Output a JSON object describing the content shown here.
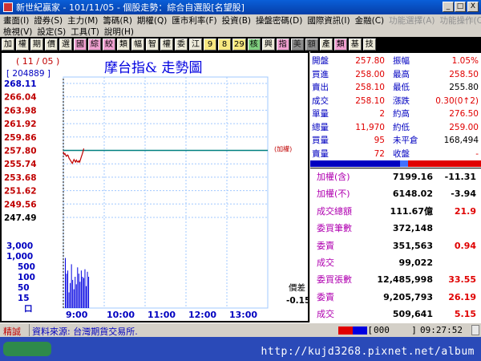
{
  "window": {
    "title": "新世紀贏家 - 101/11/05 - 個股走勢：綜合自選股[名望股]",
    "buttons": [
      "_",
      "□",
      "X"
    ]
  },
  "menu": {
    "row1": [
      "畫面(I)",
      "證券(S)",
      "主力(M)",
      "籌碼(R)",
      "期權(Q)",
      "匯市利率(F)",
      "投資(B)",
      "操盤密碼(D)",
      "國際資訊(I)",
      "金融(C)",
      "功能選擇(A)",
      "功能操作(C)"
    ],
    "row2": [
      "檢視(V)",
      "設定(S)",
      "工具(T)",
      "說明(H)"
    ]
  },
  "toolbar": [
    "加",
    "權",
    "期",
    "價",
    "選",
    "國",
    "綜",
    "絞",
    "類",
    "幅",
    "智",
    "權",
    "委",
    "江",
    "9",
    "8",
    "29",
    "核",
    "興",
    "指",
    "美",
    "額",
    "產",
    "類",
    "基",
    "技"
  ],
  "chart": {
    "date": "( 11 / 05 )",
    "volume_code": "[ 204889 ]",
    "title": "摩台指&  走勢圖",
    "price_ticks": [
      "268.11",
      "266.04",
      "263.98",
      "261.92",
      "259.86",
      "257.80",
      "255.74",
      "253.68",
      "251.62",
      "249.56",
      "247.49"
    ],
    "volume_ticks": [
      "3,000",
      "1,000",
      "500",
      "100",
      "50",
      "15",
      "口"
    ],
    "time_ticks": [
      "9:00",
      "10:00",
      "11:00",
      "12:00",
      "13:00"
    ],
    "ref_label": "(加權)",
    "diff_label": "價差",
    "diff_value": "-0.15",
    "reference_price": 257.8,
    "price_series": [
      257.6,
      257.2,
      257.3,
      257.0,
      256.9,
      257.1,
      257.0,
      256.6,
      256.4,
      256.2,
      256.0,
      255.8,
      256.1,
      256.4,
      256.2,
      256.0,
      256.3,
      256.1,
      256.0,
      256.2,
      256.0,
      256.4,
      256.8,
      257.2,
      257.6,
      258.1
    ],
    "volume_series": [
      0.8,
      0.55,
      0.6,
      0.25,
      0.4,
      0.7,
      0.45,
      0.3,
      0.5,
      0.38,
      0.65,
      0.55,
      0.42,
      0.6,
      0.5,
      0.48,
      0.62,
      0.35,
      0.58,
      0.5
    ]
  },
  "quote": {
    "rows": [
      {
        "l1": "開盤",
        "v1": "257.80",
        "l2": "振幅",
        "v2": "1.05%",
        "c1": "red",
        "c2": "red"
      },
      {
        "l1": "買進",
        "v1": "258.00",
        "l2": "最高",
        "v2": "258.50",
        "c1": "red",
        "c2": "red"
      },
      {
        "l1": "賣出",
        "v1": "258.10",
        "l2": "最低",
        "v2": "255.80",
        "c1": "red",
        "c2": "blk"
      },
      {
        "l1": "成交",
        "v1": "258.10",
        "l2": "漲跌",
        "v2": "0.30(0↑2)",
        "c1": "red",
        "c2": "red"
      },
      {
        "l1": "單量",
        "v1": "2",
        "l2": "約高",
        "v2": "276.50",
        "c1": "red",
        "c2": "red"
      },
      {
        "l1": "總量",
        "v1": "11,970",
        "l2": "約低",
        "v2": "259.00",
        "c1": "red",
        "c2": "red"
      },
      {
        "l1": "買量",
        "v1": "95",
        "l2": "未平倉",
        "v2": "168,494",
        "c1": "red",
        "c2": "blk"
      },
      {
        "l1": "賣量",
        "v1": "72",
        "l2": "收盤",
        "v2": "-",
        "c1": "red",
        "c2": "red"
      }
    ]
  },
  "market": {
    "rows": [
      {
        "label": "加權(含)",
        "value": "7199.16",
        "change": "-11.31",
        "cv": "blk",
        "cc": "blk"
      },
      {
        "label": "加權(不)",
        "value": "6148.02",
        "change": "-3.94",
        "cv": "blk",
        "cc": "blk"
      },
      {
        "label": "成交總額",
        "value": "111.67億",
        "change": "21.9",
        "cv": "blk",
        "cc": "red"
      },
      {
        "label": "委買筆數",
        "value": "372,148",
        "change": "",
        "cv": "blk",
        "cc": "blk"
      },
      {
        "label": "委賣",
        "value": "351,563",
        "change": "0.94",
        "cv": "blk",
        "cc": "red"
      },
      {
        "label": "成交",
        "value": "99,022",
        "change": "",
        "cv": "blk",
        "cc": "blk"
      },
      {
        "label": "委買張數",
        "value": "12,485,998",
        "change": "33.55",
        "cv": "blk",
        "cc": "red"
      },
      {
        "label": "委賣",
        "value": "9,205,793",
        "change": "26.19",
        "cv": "blk",
        "cc": "red"
      },
      {
        "label": "成交",
        "value": "509,641",
        "change": "5.15",
        "cv": "blk",
        "cc": "red"
      }
    ]
  },
  "status": {
    "left_label": "精誠",
    "source": "資料來源: 台灣期貨交易所.",
    "counter": "000",
    "time": "09:27:52"
  },
  "watermark": "http://kujd3268.pixnet.net/album",
  "colors": {
    "title_bg": "#063ea8",
    "toolbar_bg": "#000000",
    "price_line": "#c00000",
    "ref_line": "#008080",
    "volume_bar": "#0000e0",
    "grid": "#a0c8ff"
  }
}
